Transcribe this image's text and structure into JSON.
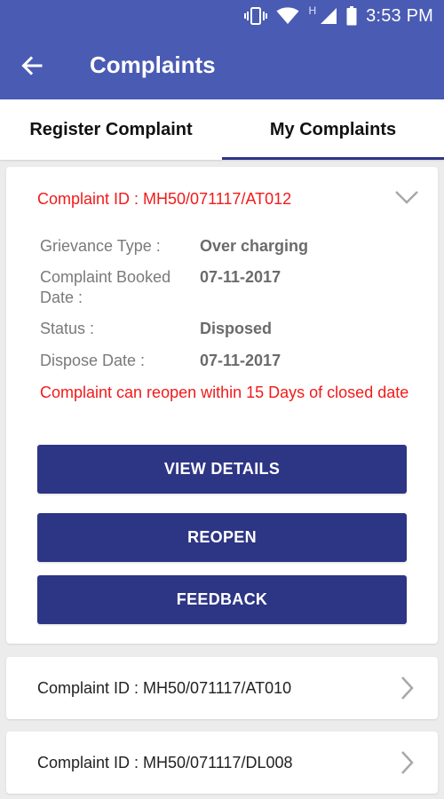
{
  "status_bar": {
    "time": "3:53 PM",
    "network_label": "H",
    "icons": [
      "vibrate-icon",
      "wifi-icon",
      "signal-icon",
      "battery-icon"
    ]
  },
  "app_bar": {
    "title": "Complaints",
    "back_icon": "arrow-left-icon"
  },
  "tabs": [
    {
      "label": "Register Complaint",
      "active": false
    },
    {
      "label": "My Complaints",
      "active": true
    }
  ],
  "expanded_complaint": {
    "id_text": "Complaint ID : MH50/071117/AT012",
    "details": [
      {
        "label": "Grievance Type :",
        "value": "Over charging"
      },
      {
        "label": "Complaint Booked Date :",
        "value": "07-11-2017"
      },
      {
        "label": "Status :",
        "value": "Disposed"
      },
      {
        "label": "Dispose Date :",
        "value": "07-11-2017"
      }
    ],
    "note": "Complaint can reopen within 15 Days of closed date",
    "buttons": {
      "view_details": "VIEW DETAILS",
      "reopen": "REOPEN",
      "feedback": "FEEDBACK"
    }
  },
  "collapsed_complaints": [
    {
      "id_text": "Complaint ID : MH50/071117/AT010"
    },
    {
      "id_text": "Complaint ID : MH50/071117/DL008"
    }
  ],
  "colors": {
    "header": "#4a5bb4",
    "button": "#2d3585",
    "alert_red": "#f21a1a",
    "tab_indicator": "#2f3486",
    "background": "#ececec"
  }
}
